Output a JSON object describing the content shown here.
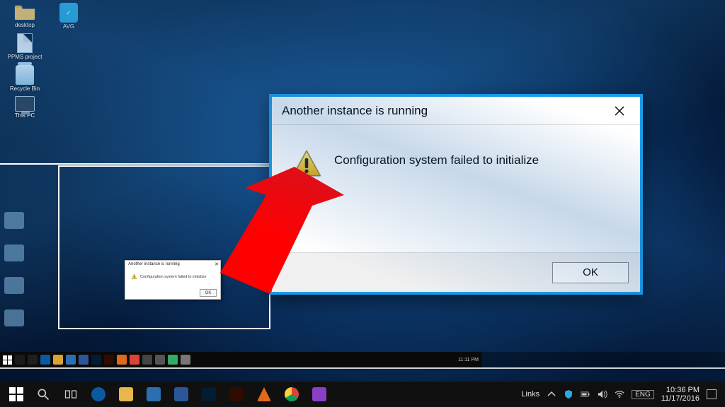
{
  "desktop": {
    "icons_col1": [
      {
        "label": "desktop",
        "name": "desktop-folder"
      },
      {
        "label": "PPMS project",
        "name": "ppms-project-doc"
      },
      {
        "label": "Recycle Bin",
        "name": "recycle-bin"
      },
      {
        "label": "This PC",
        "name": "this-pc"
      }
    ],
    "icons_col2": [
      {
        "label": "AVG",
        "name": "avg-app"
      }
    ]
  },
  "inner_taskbar": {
    "time": "11:11 PM",
    "apps": [
      "start",
      "search",
      "taskview",
      "edge",
      "explorer",
      "store",
      "word",
      "ps",
      "ai",
      "vlc",
      "chrome",
      "zen",
      "misc1",
      "misc2",
      "disc"
    ]
  },
  "mini_dialog": {
    "title": "Another instance is running",
    "message": "Configuration system failed to initialize",
    "ok": "OK"
  },
  "dialog": {
    "title": "Another instance is running",
    "message": "Configuration system failed to initialize",
    "ok": "OK"
  },
  "outer_taskbar": {
    "links_label": "Links",
    "lang": "ENG",
    "time": "10:36 PM",
    "date": "11/17/2016",
    "apps": [
      "start",
      "search",
      "taskview",
      "edge",
      "explorer",
      "store",
      "word",
      "ps",
      "ai",
      "vlc",
      "chrome",
      "zen"
    ]
  },
  "colors": {
    "dialog_accent": "#1a9be8",
    "arrow": "#ff0000"
  }
}
